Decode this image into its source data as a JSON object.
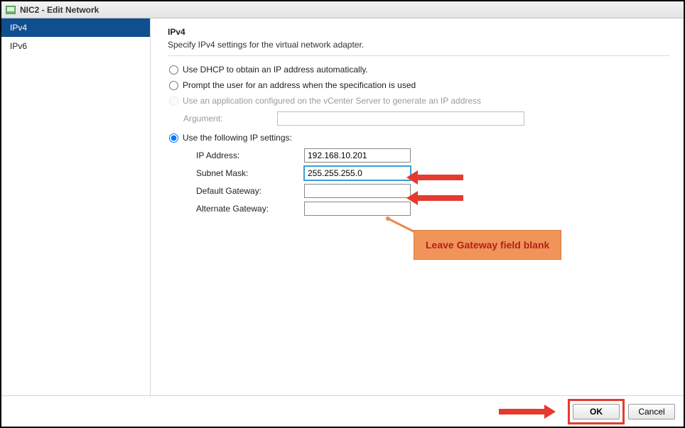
{
  "window": {
    "title": "NIC2 - Edit Network"
  },
  "sidebar": {
    "items": [
      {
        "label": "IPv4",
        "selected": true
      },
      {
        "label": "IPv6",
        "selected": false
      }
    ]
  },
  "main": {
    "heading": "IPv4",
    "subheading": "Specify IPv4 settings for the virtual network adapter.",
    "radios": {
      "dhcp": "Use DHCP to obtain an IP address automatically.",
      "prompt": "Prompt the user for an address when the specification is used",
      "app": "Use an application configured on the vCenter Server to generate an IP address",
      "static": "Use the following IP settings:"
    },
    "argument_label": "Argument:",
    "fields": {
      "ip_label": "IP Address:",
      "ip_value": "192.168.10.201",
      "mask_label": "Subnet Mask:",
      "mask_value": "255.255.255.0",
      "gw_label": "Default Gateway:",
      "gw_value": "",
      "altgw_label": "Alternate Gateway:",
      "altgw_value": ""
    }
  },
  "annotations": {
    "callout_text": "Leave Gateway field blank"
  },
  "footer": {
    "ok": "OK",
    "cancel": "Cancel"
  }
}
